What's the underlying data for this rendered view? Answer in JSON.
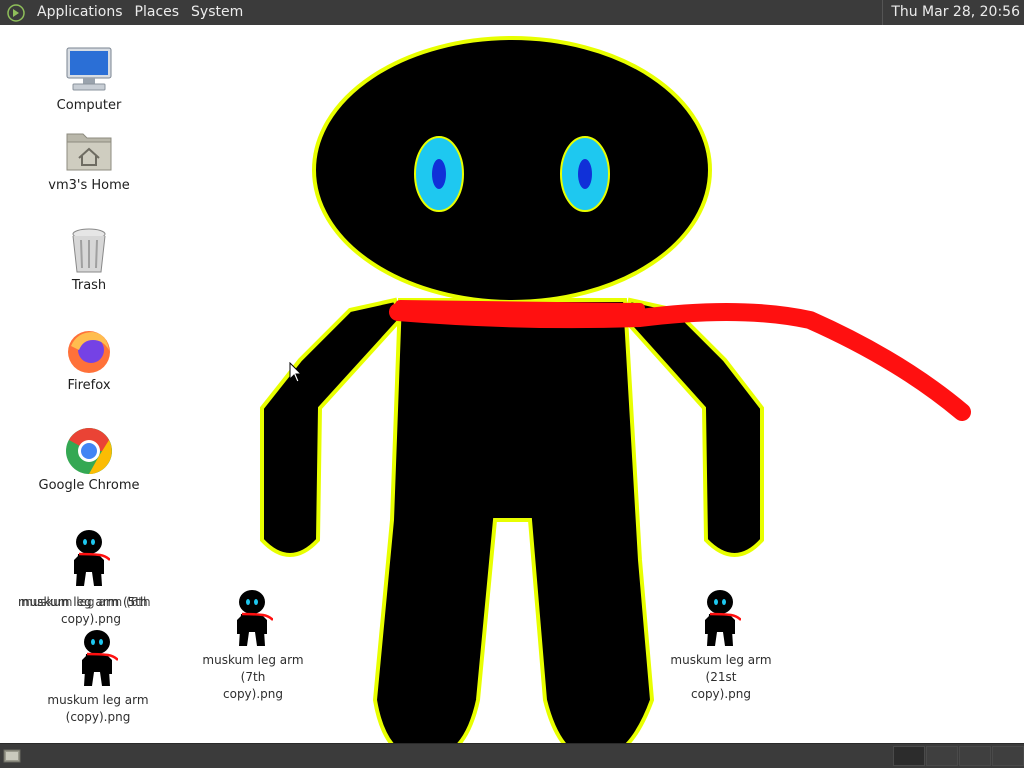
{
  "top_panel": {
    "menus": [
      "Applications",
      "Places",
      "System"
    ],
    "clock": "Thu Mar 28, 20:56"
  },
  "desktop": {
    "icons": [
      {
        "label": "Computer",
        "icon": "computer-icon"
      },
      {
        "label": "vm3's Home",
        "icon": "home-folder-icon"
      },
      {
        "label": "Trash",
        "icon": "trash-icon"
      },
      {
        "label": "Firefox",
        "icon": "firefox-icon"
      },
      {
        "label": "Google Chrome",
        "icon": "chrome-icon"
      }
    ],
    "files": [
      {
        "label_line1": "muskum leg arm (7th",
        "label_line2": "copy).png"
      },
      {
        "label_line1": "muskum leg arm (21st",
        "label_line2": "copy).png"
      },
      {
        "label_line1": "muskum leg arm",
        "label_line2": "(copy).png"
      }
    ],
    "overlapping_file": {
      "label_a": "muskum leg arm (5th",
      "label_b": "muskum leg arm (6th",
      "label_line2": "copy).png"
    }
  },
  "colors": {
    "panel": "#3b3b3b",
    "figure_body": "#000000",
    "figure_outline": "#e8ff00",
    "eye_outer": "#1ec8f0",
    "eye_inner": "#1030d8",
    "scarf": "#ff1010"
  }
}
